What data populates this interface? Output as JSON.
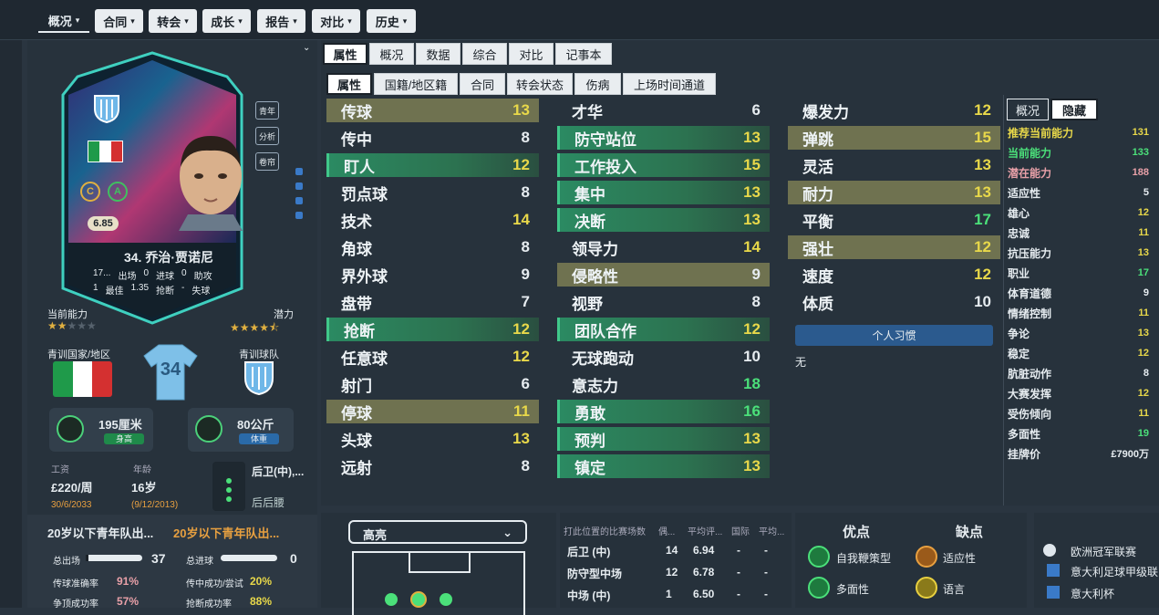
{
  "top_nav": [
    {
      "label": "概况",
      "active": true
    },
    {
      "label": "合同"
    },
    {
      "label": "转会"
    },
    {
      "label": "成长"
    },
    {
      "label": "报告"
    },
    {
      "label": "对比"
    },
    {
      "label": "历史"
    }
  ],
  "player": {
    "number_name": "34. 乔治·贾诺尼",
    "rating": "6.85",
    "badges": [
      "青年",
      "分析",
      "卷帘"
    ],
    "role_badges": [
      "C",
      "A"
    ],
    "stats_row1": [
      {
        "v": "17...",
        "k": "出场"
      },
      {
        "v": "0",
        "k": "进球"
      },
      {
        "v": "0",
        "k": "助攻"
      }
    ],
    "stats_row2": [
      {
        "v": "1",
        "k": "最佳"
      },
      {
        "v": "1.35",
        "k": "抢断"
      },
      {
        "v": "-",
        "k": "失球"
      }
    ],
    "current_ability_label": "当前能力",
    "potential_label": "潜力",
    "current_ability_stars": 2,
    "potential_stars": 4.5,
    "youth_nation_label": "青训国家/地区",
    "youth_club_label": "青训球队",
    "shirt_number": "34",
    "height": "195厘米",
    "height_tag": "身高",
    "weight": "80公斤",
    "weight_tag": "体重",
    "wage_label": "工资",
    "wage": "£220/周",
    "wage_date": "30/6/2033",
    "age_label": "年龄",
    "age": "16岁",
    "dob": "(9/12/2013)",
    "position": "后卫(中),...",
    "position2": "后后腰"
  },
  "u20": {
    "left_title": "20岁以下青年队出...",
    "right_title": "20岁以下青年队出...",
    "rows": [
      {
        "a_label": "总出场",
        "a_val": "37",
        "b_label": "总进球",
        "b_val": "0"
      },
      {
        "a_label": "传球准确率",
        "a_val": "91%",
        "b_label": "传中成功/尝试",
        "b_val": "20%"
      },
      {
        "a_label": "争顶成功率",
        "a_val": "57%",
        "b_label": "抢断成功率",
        "b_val": "88%"
      }
    ]
  },
  "main_tabs": [
    "属性",
    "概况",
    "数据",
    "综合",
    "对比",
    "记事本"
  ],
  "sub_tabs": [
    "属性",
    "国籍/地区籍",
    "合同",
    "转会状态",
    "伤病",
    "上场时间通道"
  ],
  "attributes": {
    "col1": [
      {
        "n": "传球",
        "v": "13",
        "s": "o"
      },
      {
        "n": "传中",
        "v": "8",
        "s": ""
      },
      {
        "n": "盯人",
        "v": "12",
        "s": "g"
      },
      {
        "n": "罚点球",
        "v": "8",
        "s": ""
      },
      {
        "n": "技术",
        "v": "14",
        "s": ""
      },
      {
        "n": "角球",
        "v": "8",
        "s": ""
      },
      {
        "n": "界外球",
        "v": "9",
        "s": ""
      },
      {
        "n": "盘带",
        "v": "7",
        "s": ""
      },
      {
        "n": "抢断",
        "v": "12",
        "s": "g"
      },
      {
        "n": "任意球",
        "v": "12",
        "s": ""
      },
      {
        "n": "射门",
        "v": "6",
        "s": ""
      },
      {
        "n": "停球",
        "v": "11",
        "s": "o"
      },
      {
        "n": "头球",
        "v": "13",
        "s": ""
      },
      {
        "n": "远射",
        "v": "8",
        "s": ""
      }
    ],
    "col2": [
      {
        "n": "才华",
        "v": "6",
        "s": ""
      },
      {
        "n": "防守站位",
        "v": "13",
        "s": "g"
      },
      {
        "n": "工作投入",
        "v": "15",
        "s": "g"
      },
      {
        "n": "集中",
        "v": "13",
        "s": "g"
      },
      {
        "n": "决断",
        "v": "13",
        "s": "g"
      },
      {
        "n": "领导力",
        "v": "14",
        "s": ""
      },
      {
        "n": "侵略性",
        "v": "9",
        "s": "o"
      },
      {
        "n": "视野",
        "v": "8",
        "s": ""
      },
      {
        "n": "团队合作",
        "v": "12",
        "s": "g"
      },
      {
        "n": "无球跑动",
        "v": "10",
        "s": ""
      },
      {
        "n": "意志力",
        "v": "18",
        "s": ""
      },
      {
        "n": "勇敢",
        "v": "16",
        "s": "g"
      },
      {
        "n": "预判",
        "v": "13",
        "s": "g"
      },
      {
        "n": "镇定",
        "v": "13",
        "s": "g"
      }
    ],
    "col3": [
      {
        "n": "爆发力",
        "v": "12",
        "s": ""
      },
      {
        "n": "弹跳",
        "v": "15",
        "s": "o"
      },
      {
        "n": "灵活",
        "v": "13",
        "s": ""
      },
      {
        "n": "耐力",
        "v": "13",
        "s": "o"
      },
      {
        "n": "平衡",
        "v": "17",
        "s": ""
      },
      {
        "n": "强壮",
        "v": "12",
        "s": "o"
      },
      {
        "n": "速度",
        "v": "12",
        "s": ""
      },
      {
        "n": "体质",
        "v": "10",
        "s": ""
      }
    ]
  },
  "habits": {
    "button": "个人习惯",
    "value": "无"
  },
  "hidden_tabs": [
    "概况",
    "隐藏"
  ],
  "hidden": [
    {
      "n": "推荐当前能力",
      "v": "131",
      "c": "#e8d84a"
    },
    {
      "n": "当前能力",
      "v": "133",
      "c": "#4be07a"
    },
    {
      "n": "潜在能力",
      "v": "188",
      "c": "#e8a0a8"
    },
    {
      "n": "适应性",
      "v": "5",
      "c": "#e6ecf0"
    },
    {
      "n": "雄心",
      "v": "12",
      "c": "#e8d84a"
    },
    {
      "n": "忠诚",
      "v": "11",
      "c": "#e8d84a"
    },
    {
      "n": "抗压能力",
      "v": "13",
      "c": "#e8d84a"
    },
    {
      "n": "职业",
      "v": "17",
      "c": "#4be07a"
    },
    {
      "n": "体育道德",
      "v": "9",
      "c": "#e6ecf0"
    },
    {
      "n": "情绪控制",
      "v": "11",
      "c": "#e8d84a"
    },
    {
      "n": "争论",
      "v": "13",
      "c": "#e8d84a"
    },
    {
      "n": "稳定",
      "v": "12",
      "c": "#e8d84a"
    },
    {
      "n": "肮脏动作",
      "v": "8",
      "c": "#e6ecf0"
    },
    {
      "n": "大赛发挥",
      "v": "12",
      "c": "#e8d84a"
    },
    {
      "n": "受伤倾向",
      "v": "11",
      "c": "#e8d84a"
    },
    {
      "n": "多面性",
      "v": "19",
      "c": "#4be07a"
    },
    {
      "n": "挂牌价",
      "v": "£7900万",
      "c": "#e6ecf0"
    }
  ],
  "highlights": {
    "select": "高亮"
  },
  "positions_table": {
    "headers": [
      "打此位置的比赛场数",
      "偶...",
      "平均评...",
      "国际",
      "平均..."
    ],
    "rows": [
      {
        "pos": "后卫 (中)",
        "games": "14",
        "avg": "6.94",
        "intl": "-",
        "avg2": "-"
      },
      {
        "pos": "防守型中场",
        "games": "12",
        "avg": "6.78",
        "intl": "-",
        "avg2": "-"
      },
      {
        "pos": "中场 (中)",
        "games": "1",
        "avg": "6.50",
        "intl": "-",
        "avg2": "-"
      }
    ]
  },
  "traits": {
    "pros_title": "优点",
    "cons_title": "缺点",
    "pros": [
      "自我鞭策型",
      "多面性"
    ],
    "cons": [
      "适应性",
      "语言"
    ]
  },
  "competitions": [
    "欧洲冠军联赛",
    "意大利足球甲级联",
    "意大利杯"
  ]
}
